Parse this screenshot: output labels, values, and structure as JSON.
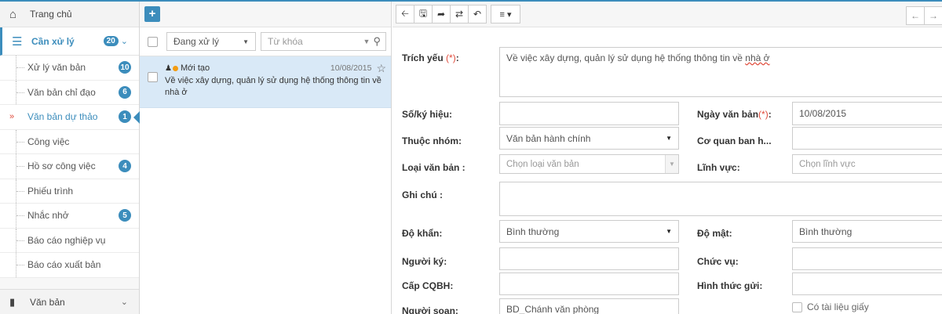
{
  "sidebar": {
    "home_label": "Trang chủ",
    "group": {
      "label": "Cần xử lý",
      "badge": "20"
    },
    "items": [
      {
        "label": "Xử lý văn bản",
        "badge": "10"
      },
      {
        "label": "Văn bản chỉ đạo",
        "badge": "6"
      },
      {
        "label": "Văn bản dự thảo",
        "badge": "1",
        "active": true
      },
      {
        "label": "Công việc",
        "badge": ""
      },
      {
        "label": "Hồ sơ công việc",
        "badge": "4"
      },
      {
        "label": "Phiếu trình",
        "badge": ""
      },
      {
        "label": "Nhắc nhở",
        "badge": "5"
      },
      {
        "label": "Báo cáo nghiệp vụ",
        "badge": ""
      },
      {
        "label": "Báo cáo xuất bản",
        "badge": ""
      }
    ],
    "footer_label": "Văn bản"
  },
  "list": {
    "add_label": "+",
    "status_filter": "Đang xử lý",
    "keyword_placeholder": "Từ khóa",
    "rows": [
      {
        "status": "Mới tạo",
        "date": "10/08/2015",
        "title": "Về việc xây dựng, quản lý sử dụng hệ thống thông tin về nhà ở"
      }
    ]
  },
  "form": {
    "trich_yeu_label": "Trích yếu",
    "required_mark": "(*)",
    "trich_yeu_value": "Về việc xây dựng, quản lý sử dụng hệ thống thông tin về",
    "trich_yeu_tail": "nhà ở",
    "so_ky_hieu_label": "Số/ký hiệu:",
    "so_ky_hieu_value": "",
    "ngay_van_ban_label": "Ngày văn bản",
    "ngay_van_ban_value": "10/08/2015",
    "thuoc_nhom_label": "Thuộc nhóm:",
    "thuoc_nhom_value": "Văn bản hành chính",
    "co_quan_label": "Cơ quan ban h...",
    "co_quan_value": "",
    "loai_van_ban_label": "Loại văn bản :",
    "loai_van_ban_placeholder": "Chọn loại văn bản",
    "linh_vuc_label": "Lĩnh vực:",
    "linh_vuc_placeholder": "Chọn lĩnh vực",
    "ghi_chu_label": "Ghi chú :",
    "ghi_chu_value": "",
    "do_khan_label": "Độ khẩn:",
    "do_khan_value": "Bình thường",
    "do_mat_label": "Độ mật:",
    "do_mat_value": "Bình thường",
    "nguoi_ky_label": "Người ký:",
    "nguoi_ky_value": "",
    "chuc_vu_label": "Chức vụ:",
    "chuc_vu_value": "",
    "cap_cqbh_label": "Cấp CQBH:",
    "cap_cqbh_value": "",
    "hinh_thuc_gui_label": "Hình thức gửi:",
    "hinh_thuc_gui_value": "",
    "nguoi_soan_label": "Người soạn:",
    "nguoi_soan_value": "BD_Chánh văn phòng",
    "co_tai_lieu_giay_label": "Có tài liệu giấy"
  },
  "colors": {
    "accent": "#3c8dbc",
    "selected_row": "#d9e9f7",
    "required": "#e04b3b",
    "status_dot": "#f39c12"
  },
  "icons": [
    "home-icon",
    "inbox-icon",
    "book-icon",
    "plus-icon",
    "search-icon",
    "star-icon",
    "user-icon",
    "back-icon",
    "save-icon",
    "forward-icon",
    "retweet-icon",
    "undo-icon",
    "menu-icon"
  ]
}
